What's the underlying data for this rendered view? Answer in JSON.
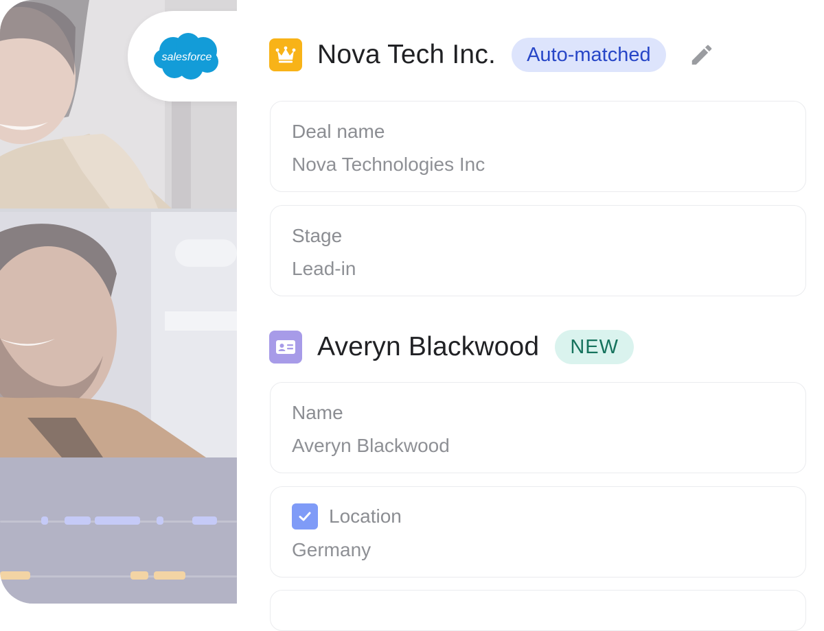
{
  "left_panel": {
    "salesforce_logo_text": "salesforce"
  },
  "company": {
    "name": "Nova Tech Inc.",
    "match_status": "Auto-matched",
    "fields": [
      {
        "label": "Deal name",
        "value": "Nova Technologies Inc"
      },
      {
        "label": "Stage",
        "value": "Lead-in"
      }
    ]
  },
  "contact": {
    "name": "Averyn Blackwood",
    "status_badge": "NEW",
    "fields": [
      {
        "label": "Name",
        "value": "Averyn Blackwood"
      },
      {
        "label": "Location",
        "value": "Germany",
        "checked": true
      }
    ]
  },
  "colors": {
    "crown_icon_bg": "#f8b318",
    "contact_icon_bg": "#a79be8",
    "auto_matched_pill_bg": "#dde4fc",
    "auto_matched_text": "#2746c7",
    "new_pill_bg": "#daf3ee",
    "new_text": "#16735d",
    "checkbox": "#7f9bf7",
    "salesforce_blue": "#139cd8"
  },
  "icons": {
    "company_icon": "crown-icon",
    "contact_icon": "contact-card-icon",
    "edit_icon": "pencil-icon",
    "location_check": "checkbox-checked-icon"
  }
}
